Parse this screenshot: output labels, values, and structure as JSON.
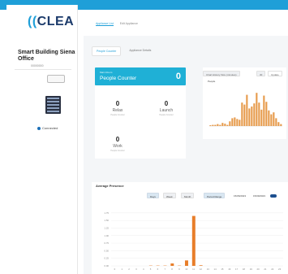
{
  "app": {
    "logo_text": "CLEA",
    "logo_prefix": "((",
    "site_name": "Smart Building Siena Office",
    "site_sub": "00000000",
    "status_label": "Connected",
    "accent_color": "#1f9fd8"
  },
  "nav": {
    "tabs": [
      {
        "label": "Appliances",
        "icon": "grid-icon",
        "active": true
      },
      {
        "label": "Clients",
        "icon": "grid-icon",
        "active": false
      },
      {
        "label": "Users",
        "icon": "user-icon",
        "active": false
      }
    ],
    "subtabs": [
      {
        "label": "Appliance List",
        "active": true
      },
      {
        "label": "Edit Appliance",
        "active": false
      }
    ]
  },
  "content_tabs": [
    {
      "label": "People Counter",
      "active": true
    },
    {
      "label": "Appliance Details",
      "active": false
    }
  ],
  "people_counter": {
    "small_label": "Main Room",
    "title": "People Counter",
    "value": "0",
    "counters": [
      {
        "value": "0",
        "label": "Relax",
        "sub": "People Counter"
      },
      {
        "value": "0",
        "label": "Launch",
        "sub": "People Counter"
      },
      {
        "value": "0",
        "label": "Work",
        "sub": "People Counter"
      }
    ]
  },
  "history_chart": {
    "button_label": "Chart History Size (minutes)",
    "size_value": "30",
    "update_label": "Update",
    "legend": "People"
  },
  "average_presence": {
    "title": "Average Presence",
    "buttons": [
      "Days",
      "Week",
      "Month",
      "Period Range"
    ],
    "selected_button": "Period Range",
    "date_from": "15/06/2023",
    "date_to": "15/09/2023"
  },
  "chart_data": [
    {
      "type": "bar",
      "x": [
        1,
        2,
        3,
        4,
        5,
        6,
        7,
        8,
        9,
        10,
        11,
        12,
        13,
        14,
        15,
        16,
        17,
        18,
        19,
        20,
        21,
        22,
        23,
        24,
        25,
        26,
        27,
        28,
        29,
        30
      ],
      "values": [
        0.02,
        0.03,
        0.03,
        0.05,
        0.03,
        0.08,
        0.06,
        0.03,
        0.12,
        0.2,
        0.22,
        0.18,
        0.16,
        0.6,
        0.55,
        0.8,
        0.45,
        0.5,
        0.58,
        0.85,
        0.6,
        0.42,
        0.78,
        0.62,
        0.4,
        0.3,
        0.35,
        0.2,
        0.1,
        0.05
      ],
      "ylim": [
        0,
        1
      ]
    },
    {
      "type": "bar",
      "categories": [
        "0",
        "1",
        "2",
        "3",
        "4",
        "5",
        "6",
        "7",
        "8",
        "9",
        "10",
        "11",
        "12",
        "13",
        "14",
        "15",
        "16",
        "17",
        "18",
        "19",
        "20",
        "21",
        "22",
        "23"
      ],
      "values": [
        0,
        0,
        0,
        0,
        0,
        0.01,
        0.01,
        0.01,
        0.08,
        0.01,
        0.18,
        1.65,
        0.02,
        0,
        0,
        0,
        0,
        0,
        0,
        0,
        0,
        0,
        0,
        0
      ],
      "ylim": [
        0,
        1.8
      ],
      "yticks": [
        "0.00",
        "0.25",
        "0.50",
        "0.75",
        "1.00",
        "1.25",
        "1.50",
        "1.75"
      ]
    }
  ]
}
